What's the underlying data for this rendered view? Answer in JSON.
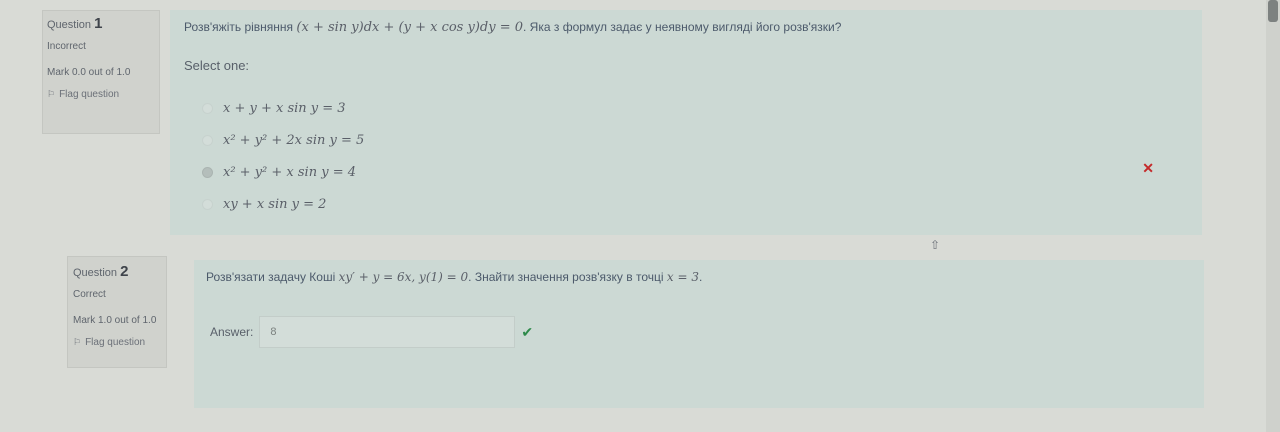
{
  "question1": {
    "number_label": "Question",
    "number": "1",
    "state": "Incorrect",
    "mark": "Mark 0.0 out of 1.0",
    "flag_label": "Flag question",
    "text_prefix": "Розв'яжіть рівняння",
    "equation": "(x + sin y)dx + (y + x cos y)dy = 0",
    "text_suffix": ". Яка з формул задає у неявному вигляді його розв'язки?",
    "select_label": "Select one:",
    "options": [
      "x + y + x sin y = 3",
      "x² + y² + 2x sin y = 5",
      "x² + y² + x sin y = 4",
      "xy + x sin y = 2"
    ],
    "selected_index": 2,
    "result_icon": "incorrect-cross-icon"
  },
  "question2": {
    "number_label": "Question",
    "number": "2",
    "state": "Correct",
    "mark": "Mark 1.0 out of 1.0",
    "flag_label": "Flag question",
    "text_prefix": "Розв'язати задачу Коші",
    "equation": "xy′ + y = 6x, y(1) = 0",
    "text_middle": ". Знайти значення розв'язку в точці",
    "point": "x = 3",
    "text_suffix": ".",
    "answer_label": "Answer:",
    "answer_value": "8",
    "result_icon": "correct-check-icon"
  },
  "colors": {
    "incorrect": "#c42a2a",
    "correct": "#2d8a4a",
    "panel": "#ccd9d4"
  }
}
